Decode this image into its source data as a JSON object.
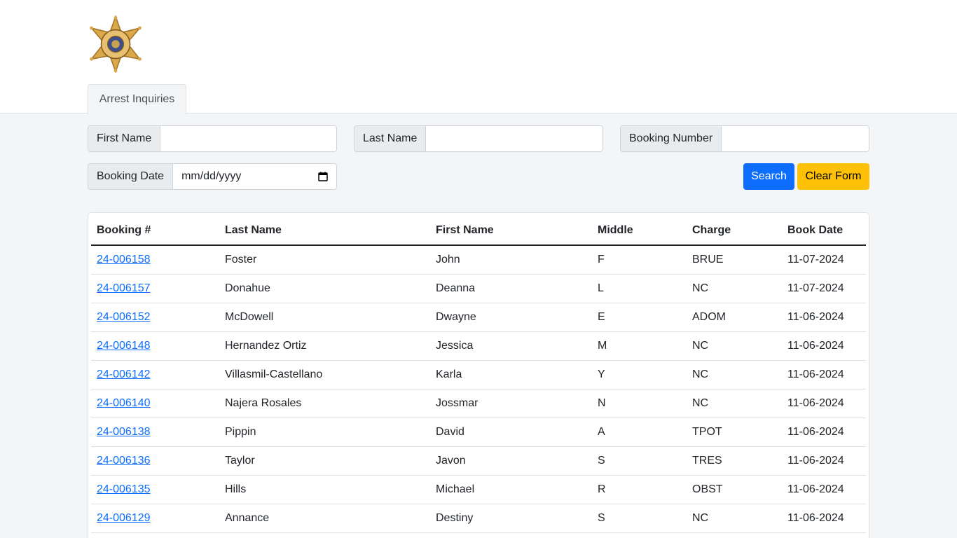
{
  "header": {
    "logo_alt": "SHERIFF CUMBERLAND COUNTY SHERIFF'S OFFICE ME"
  },
  "tabs": [
    {
      "label": "Arrest Inquiries",
      "active": true
    }
  ],
  "form": {
    "first_name_label": "First Name",
    "first_name_value": "",
    "last_name_label": "Last Name",
    "last_name_value": "",
    "booking_number_label": "Booking Number",
    "booking_number_value": "",
    "booking_date_label": "Booking Date",
    "booking_date_placeholder": "mm/dd/yyyy",
    "search_label": "Search",
    "clear_label": "Clear Form"
  },
  "colors": {
    "primary": "#0d6efd",
    "warning": "#ffc107",
    "badge_gold": "#d9a94a"
  },
  "table": {
    "headers": [
      "Booking #",
      "Last Name",
      "First Name",
      "Middle",
      "Charge",
      "Book Date"
    ],
    "rows": [
      {
        "booking": "24-006158",
        "last": "Foster",
        "first": "John",
        "middle": "F",
        "charge": "BRUE",
        "date": "11-07-2024"
      },
      {
        "booking": "24-006157",
        "last": "Donahue",
        "first": "Deanna",
        "middle": "L",
        "charge": "NC",
        "date": "11-07-2024"
      },
      {
        "booking": "24-006152",
        "last": "McDowell",
        "first": "Dwayne",
        "middle": "E",
        "charge": "ADOM",
        "date": "11-06-2024"
      },
      {
        "booking": "24-006148",
        "last": "Hernandez Ortiz",
        "first": "Jessica",
        "middle": "M",
        "charge": "NC",
        "date": "11-06-2024"
      },
      {
        "booking": "24-006142",
        "last": "Villasmil-Castellano",
        "first": "Karla",
        "middle": "Y",
        "charge": "NC",
        "date": "11-06-2024"
      },
      {
        "booking": "24-006140",
        "last": "Najera Rosales",
        "first": "Jossmar",
        "middle": "N",
        "charge": "NC",
        "date": "11-06-2024"
      },
      {
        "booking": "24-006138",
        "last": "Pippin",
        "first": "David",
        "middle": "A",
        "charge": "TPOT",
        "date": "11-06-2024"
      },
      {
        "booking": "24-006136",
        "last": "Taylor",
        "first": "Javon",
        "middle": "S",
        "charge": "TRES",
        "date": "11-06-2024"
      },
      {
        "booking": "24-006135",
        "last": "Hills",
        "first": "Michael",
        "middle": "R",
        "charge": "OBST",
        "date": "11-06-2024"
      },
      {
        "booking": "24-006129",
        "last": "Annance",
        "first": "Destiny",
        "middle": "S",
        "charge": "NC",
        "date": "11-06-2024"
      }
    ]
  }
}
